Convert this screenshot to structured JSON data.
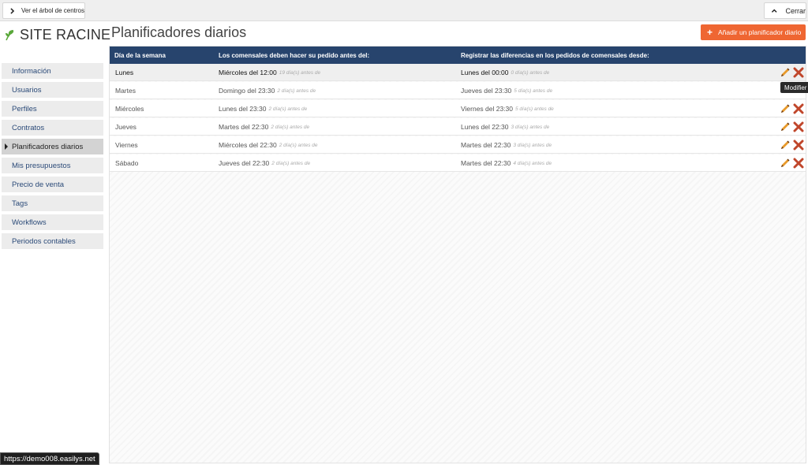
{
  "topbar": {
    "tree_button_label": "Ver el árbol de centros",
    "close_label": "Cerrar"
  },
  "logo": {
    "text": "SITE RACINE"
  },
  "page_title": "Planificadores diarios",
  "add_button_label": "Añadir un planificador diario",
  "sidebar": {
    "items": [
      {
        "label": "Información",
        "active": false
      },
      {
        "label": "Usuarios",
        "active": false
      },
      {
        "label": "Perfiles",
        "active": false
      },
      {
        "label": "Contratos",
        "active": false
      },
      {
        "label": "Planificadores diarios",
        "active": true
      },
      {
        "label": "Mis presupuestos",
        "active": false
      },
      {
        "label": "Precio de venta",
        "active": false
      },
      {
        "label": "Tags",
        "active": false
      },
      {
        "label": "Workflows",
        "active": false
      },
      {
        "label": "Periodos contables",
        "active": false
      }
    ]
  },
  "table": {
    "headers": [
      "Día de la semana",
      "Los comensales deben hacer su pedido antes del:",
      "Registrar las diferencias en los pedidos de comensales desde:"
    ],
    "rows": [
      {
        "day": "Lunes",
        "order_deadline": "Miércoles del 12:00",
        "order_hint": "19 día(s) antes de",
        "diff_from": "Lunes del 00:00",
        "diff_hint": "0 día(s) antes de"
      },
      {
        "day": "Martes",
        "order_deadline": "Domingo del 23:30",
        "order_hint": "2 día(s) antes de",
        "diff_from": "Jueves del 23:30",
        "diff_hint": "5 día(s) antes de"
      },
      {
        "day": "Miércoles",
        "order_deadline": "Lunes del 23:30",
        "order_hint": "2 día(s) antes de",
        "diff_from": "Viernes del 23:30",
        "diff_hint": "5 día(s) antes de"
      },
      {
        "day": "Jueves",
        "order_deadline": "Martes del 22:30",
        "order_hint": "2 día(s) antes de",
        "diff_from": "Lunes del 22:30",
        "diff_hint": "3 día(s) antes de"
      },
      {
        "day": "Viernes",
        "order_deadline": "Miércoles del 22:30",
        "order_hint": "2 día(s) antes de",
        "diff_from": "Martes del 22:30",
        "diff_hint": "3 día(s) antes de"
      },
      {
        "day": "Sábado",
        "order_deadline": "Jueves del 22:30",
        "order_hint": "2 día(s) antes de",
        "diff_from": "Martes del 22:30",
        "diff_hint": "4 día(s) antes de"
      }
    ]
  },
  "tooltip": "Modifier",
  "status_url": "https://demo008.easilys.net",
  "colors": {
    "header_bg": "#27446d",
    "accent": "#ef6632",
    "edit_icon": "#e89a2b",
    "delete_icon": "#c0462b",
    "logo_leaf": "#5aa83a"
  }
}
